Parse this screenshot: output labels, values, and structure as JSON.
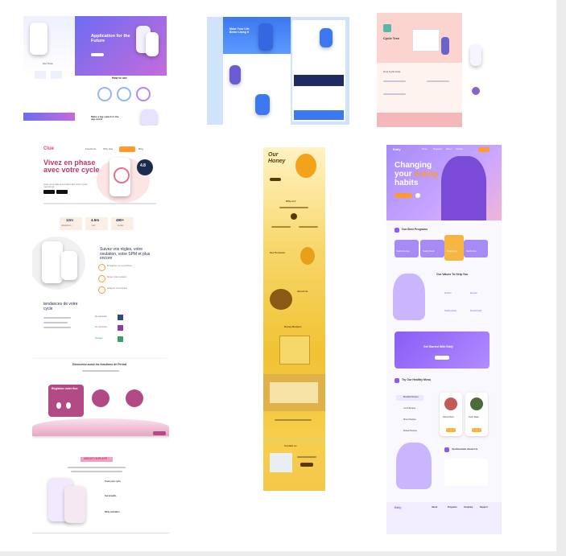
{
  "canvas": {
    "background": "#ececec",
    "board": "#ffffff"
  },
  "thumb_app": {
    "hero_title": "Application for the Future",
    "section_title": "How to use",
    "footer_line": "Make a big splash in the app world",
    "brand_label": "Our Trust"
  },
  "thumb_blue": {
    "hero_title": "Make Your Life Better Using It"
  },
  "thumb_pastel": {
    "hero_title": "Cycle Tree",
    "section_title": "How Cycle Help"
  },
  "thumb_cycle": {
    "logo": "Clue",
    "nav_items": [
      "Fonctions",
      "Why clue",
      "Télécharger",
      "Blog"
    ],
    "nav_cta": "Download",
    "hero_title": "Vivez en phase avec votre cycle",
    "hero_sub": "Clue vous aide à comprendre votre cycle menstruel.",
    "rating": "4.8",
    "stats": [
      {
        "value": "12m",
        "label": "utilisatrices"
      },
      {
        "value": "4.5m",
        "label": "avis"
      },
      {
        "value": "490+",
        "label": "études"
      }
    ],
    "feature_title": "Suivez vos règles, votre ovulation, votre SPM et plus encore",
    "trends_title": "tendances de votre cycle",
    "feature_items": [
      "Enregistrez vos symptômes",
      "Suivez votre ovulation",
      "Analysez vos données"
    ],
    "social_items": [
      "Se connecter",
      "Se connecter",
      "Partager"
    ],
    "functions_title": "Découvrez aussi les fonctions de Period",
    "functions_card": "Registrez votre flux",
    "about_title": "ABOUT OUR APP",
    "about_items": [
      "Track your cycle",
      "Get insights",
      "Daily reminders"
    ]
  },
  "thumb_honey": {
    "hero_title": "Our Honey",
    "section_1": "Why us?",
    "section_2": "Our Products",
    "section_3": "About Us",
    "section_4": "Honey Recipes",
    "cta_line": "Contact us"
  },
  "thumb_eating": {
    "logo": "Eatly",
    "nav_items": [
      "Home",
      "Programs",
      "About",
      "Contact"
    ],
    "nav_cta": "Sign up",
    "hero_title_1": "Changing",
    "hero_title_2a": "your ",
    "hero_title_2b": "eating",
    "hero_title_3": "habits",
    "hero_cta": "Get Started",
    "programs_title": "Our Best Programs",
    "programs": [
      "Healthy Recipes",
      "Healthy Meals",
      "Weight Loss",
      "Healthy Diet"
    ],
    "values_title": "Our Values To Help You",
    "values": [
      "Nutrition",
      "Exercise",
      "Healthy Eating",
      "Mental Health"
    ],
    "banner_title": "Get Started With Eatly",
    "menu_title": "Try Our Healthy Menu",
    "menu_items": [
      "Breakfast Recipes",
      "Lunch Recipes",
      "Dinner Recipes",
      "Dessert Recipes"
    ],
    "menu_cards": [
      "Salmon Bowl",
      "Fresh Salad"
    ],
    "testimonials_title": "Testimonials About Us",
    "footer_cols": [
      "About",
      "Programs",
      "Company",
      "Support"
    ]
  },
  "colors": {
    "purple": "#8a5cf6",
    "violet": "#a58bf7",
    "orange": "#ff9a2e",
    "honey": "#f7c933",
    "rose": "#b24a86",
    "sky": "#cfe3fb",
    "pink": "#f7c6c9"
  }
}
